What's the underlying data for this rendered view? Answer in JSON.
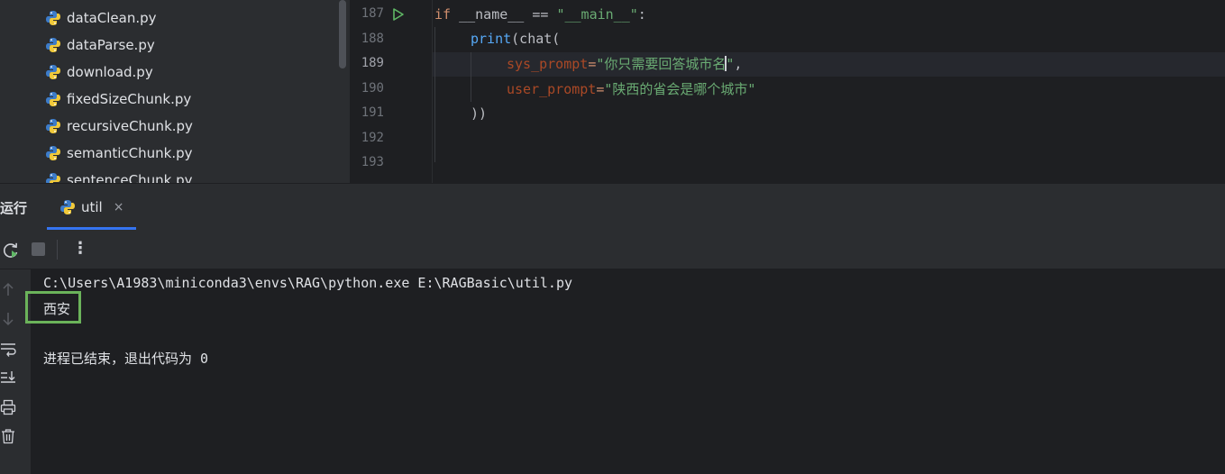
{
  "project_tree": {
    "files": [
      {
        "name": "dataClean.py",
        "icon": "python-file-icon"
      },
      {
        "name": "dataParse.py",
        "icon": "python-file-icon"
      },
      {
        "name": "download.py",
        "icon": "python-file-icon"
      },
      {
        "name": "fixedSizeChunk.py",
        "icon": "python-file-icon"
      },
      {
        "name": "recursiveChunk.py",
        "icon": "python-file-icon"
      },
      {
        "name": "semanticChunk.py",
        "icon": "python-file-icon"
      },
      {
        "name": "sentenceChunk.py",
        "icon": "python-file-icon"
      }
    ]
  },
  "editor": {
    "active_line": "189",
    "line_numbers": [
      "187",
      "188",
      "189",
      "190",
      "191",
      "192",
      "193"
    ],
    "code": {
      "l187_kw": "if",
      "l187_mid": " __name__ == ",
      "l187_str": "\"__main__\"",
      "l187_end": ":",
      "l188_fn": "print",
      "l188_rest": "(chat(",
      "l189_param": "sys_prompt",
      "l189_eq": "=",
      "l189_str_a": "\"你只需要回答城市名",
      "l189_str_b": "\"",
      "l189_end": ",",
      "l190_param": "user_prompt",
      "l190_eq": "=",
      "l190_str": "\"陕西的省会是哪个城市\"",
      "l191": "))"
    }
  },
  "run_window": {
    "title": "运行",
    "tab_label": "util",
    "tab_close": "×",
    "more_glyph": "⋮",
    "console_lines": {
      "command": "C:\\Users\\A1983\\miniconda3\\envs\\RAG\\python.exe E:\\RAGBasic\\util.py",
      "output": "西安",
      "exit": "进程已结束，退出代码为 0"
    }
  },
  "colors": {
    "background": "#1e1f22",
    "panel": "#2b2d30",
    "accent": "#3574f0",
    "highlight_box": "#6bb35a",
    "keyword": "#cf8e6d",
    "string": "#6aab73",
    "param": "#aa4926",
    "function": "#56a8f5"
  }
}
